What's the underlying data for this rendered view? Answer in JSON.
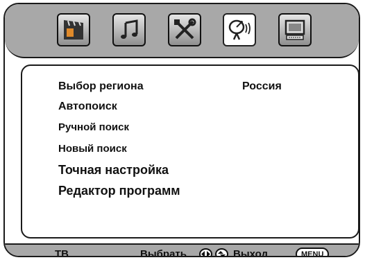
{
  "top_icons": [
    {
      "name": "movie-clapper-icon",
      "selected": false
    },
    {
      "name": "music-note-icon",
      "selected": false
    },
    {
      "name": "tools-icon",
      "selected": false
    },
    {
      "name": "satellite-dish-icon",
      "selected": true
    },
    {
      "name": "monitor-icon",
      "selected": false
    }
  ],
  "menu": {
    "items": [
      {
        "label": "Выбор региона",
        "value": "Россия"
      },
      {
        "label": "Автопоиск"
      },
      {
        "label": "Ручной поиск"
      },
      {
        "label": "Новый поиск"
      },
      {
        "label": "Точная настройка"
      },
      {
        "label": "Редактор программ"
      }
    ]
  },
  "bottom_bar": {
    "mode": "ТВ",
    "select_label": "Выбрать",
    "exit_label": "Выход",
    "menu_button": "MENU",
    "icons": [
      "left-right-arrows-icon",
      "up-down-arrows-icon"
    ]
  }
}
